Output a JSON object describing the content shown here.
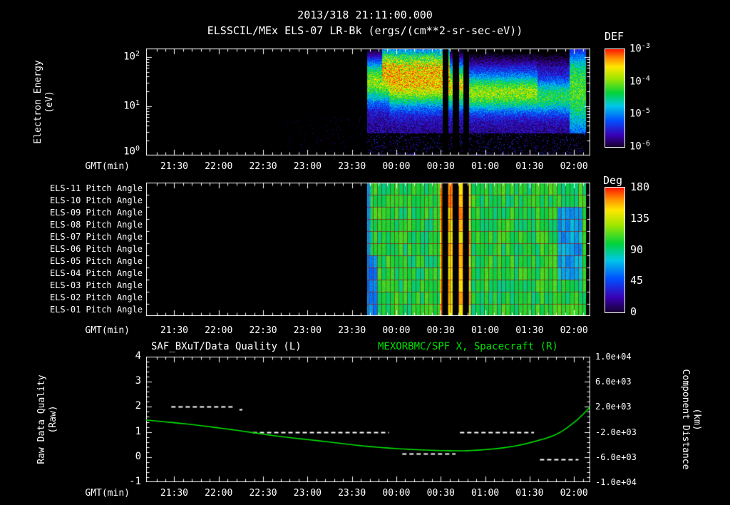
{
  "header": {
    "date": "2013/318 21:11:00.000",
    "title": "ELSSCIL/MEx ELS-07 LR-Bk (ergs/(cm**2-sr-sec-eV))"
  },
  "colormap": {
    "stops": [
      {
        "p": 0.0,
        "c": "#16002f"
      },
      {
        "p": 0.12,
        "c": "#3a00b4"
      },
      {
        "p": 0.27,
        "c": "#0050ff"
      },
      {
        "p": 0.42,
        "c": "#00c8e6"
      },
      {
        "p": 0.55,
        "c": "#00d23c"
      },
      {
        "p": 0.7,
        "c": "#a0e600"
      },
      {
        "p": 0.82,
        "c": "#ffe600"
      },
      {
        "p": 0.91,
        "c": "#ff8c00"
      },
      {
        "p": 1.0,
        "c": "#ff1400"
      }
    ]
  },
  "time_axis": {
    "start": "21:11",
    "end": "02:11",
    "span_minutes": 300,
    "ticks": [
      "21:30",
      "22:00",
      "22:30",
      "23:00",
      "23:30",
      "00:00",
      "00:30",
      "01:00",
      "01:30",
      "02:00"
    ]
  },
  "chart_data": [
    {
      "type": "heatmap",
      "name": "electron-energy-spectrogram",
      "ylabel_line1": "Electron Energy",
      "ylabel_line2": "(eV)",
      "y_scale": "log",
      "y_ticks": [
        "10^2",
        "10^1",
        "10^0"
      ],
      "x_label": "GMT(min)",
      "colorbar": {
        "label": "DEF",
        "units": "ergs/(cm**2-sr-sec-eV)",
        "ticks": [
          "10^-3",
          "10^-4",
          "10^-5",
          "10^-6"
        ],
        "log10_range": [
          -6,
          -3
        ]
      },
      "coverage": {
        "start": "23:40",
        "end": "02:08"
      },
      "gaps": [
        [
          "00:31",
          "00:35"
        ],
        [
          "00:38",
          "00:42"
        ],
        [
          "00:45",
          "00:49"
        ]
      ],
      "background_log10_flux": -5.7,
      "bands": [
        {
          "t0": "23:40",
          "t1": "23:55",
          "center_logE": 1.5,
          "width": 0.3,
          "amp": 1.7
        },
        {
          "t0": "23:55",
          "t1": "00:49",
          "center_logE": 1.42,
          "width": 0.3,
          "amp": 2.0
        },
        {
          "t0": "00:49",
          "t1": "01:35",
          "center_logE": 1.28,
          "width": 0.26,
          "amp": 1.75
        },
        {
          "t0": "01:35",
          "t1": "01:57",
          "center_logE": 1.2,
          "width": 0.24,
          "amp": 1.35
        },
        {
          "t0": "01:57",
          "t1": "02:08",
          "center_logE": 1.35,
          "width": 0.65,
          "amp": 1.5
        }
      ],
      "top_blobs": [
        {
          "t0": "23:50",
          "t1": "00:36",
          "center_logE": 1.95,
          "width": 0.25,
          "amp": 1.4
        }
      ]
    },
    {
      "type": "heatmap",
      "name": "pitch-angle-panels",
      "rows": [
        "ELS-11 Pitch Angle",
        "ELS-10 Pitch Angle",
        "ELS-09 Pitch Angle",
        "ELS-08 Pitch Angle",
        "ELS-07 Pitch Angle",
        "ELS-06 Pitch Angle",
        "ELS-05 Pitch Angle",
        "ELS-04 Pitch Angle",
        "ELS-03 Pitch Angle",
        "ELS-02 Pitch Angle",
        "ELS-01 Pitch Angle"
      ],
      "x_label": "GMT(min)",
      "colorbar": {
        "label": "Deg",
        "ticks": [
          180,
          135,
          90,
          45,
          0
        ],
        "range": [
          0,
          180
        ]
      },
      "coverage": {
        "start": "23:40",
        "end": "02:08"
      },
      "gaps": [
        [
          "00:31",
          "00:35"
        ],
        [
          "00:38",
          "00:42"
        ],
        [
          "00:45",
          "00:49"
        ]
      ],
      "typical_deg": 100,
      "hot_interval": {
        "t0": "00:29",
        "t1": "00:50",
        "deg": 150
      },
      "cool_regions": [
        {
          "t0": "23:40",
          "t1": "23:47",
          "rows": "ELS-01..ELS-05",
          "deg": 58
        },
        {
          "t0": "01:49",
          "t1": "02:05",
          "rows": "ELS-04..ELS-09",
          "deg": 62
        }
      ]
    },
    {
      "type": "line",
      "name": "quality-and-distance",
      "x_label": "GMT(min)",
      "left_axis": {
        "label_line1": "Raw Data Quality",
        "label_line2": "(Raw)",
        "ticks": [
          4,
          3,
          2,
          1,
          0,
          -1
        ],
        "range": [
          -1,
          4
        ]
      },
      "right_axis": {
        "label_line1": "Component Distance",
        "label_line2": "(km)",
        "ticks": [
          {
            "label": "1.0e+04",
            "km": 10000
          },
          {
            "label": "6.0e+03",
            "km": 6000
          },
          {
            "label": "2.0e+03",
            "km": 2000
          },
          {
            "label": "-2.0e+03",
            "km": -2000
          },
          {
            "label": "-6.0e+03",
            "km": -6000
          },
          {
            "label": "-1.0e+04",
            "km": -10000
          }
        ],
        "range_km": [
          -10000,
          10000
        ]
      },
      "left_series": {
        "name": "SAF_BXuT/Data Quality (L)",
        "color": "#ffffff",
        "style": "dashed",
        "axis": "left",
        "segments": [
          {
            "t0": "21:28",
            "t1": "22:10",
            "value": 2.0
          },
          {
            "t0": "22:14",
            "t1": "22:16",
            "value": 1.9
          },
          {
            "t0": "22:23",
            "t1": "23:55",
            "value": 1.0
          },
          {
            "t0": "00:04",
            "t1": "00:40",
            "value": 0.15
          },
          {
            "t0": "00:43",
            "t1": "01:33",
            "value": 1.0
          },
          {
            "t0": "01:37",
            "t1": "02:03",
            "value": -0.1
          }
        ]
      },
      "right_series": {
        "name": "MEXORBMC/SPF X, Spacecraft (R)",
        "color": "#00e000",
        "style": "solid",
        "axis": "right",
        "points": [
          {
            "t": "21:11",
            "km": -100
          },
          {
            "t": "21:41",
            "km": -800
          },
          {
            "t": "22:11",
            "km": -1700
          },
          {
            "t": "22:41",
            "km": -2700
          },
          {
            "t": "23:11",
            "km": -3500
          },
          {
            "t": "23:41",
            "km": -4300
          },
          {
            "t": "00:11",
            "km": -4800
          },
          {
            "t": "00:41",
            "km": -5000
          },
          {
            "t": "01:01",
            "km": -4800
          },
          {
            "t": "01:21",
            "km": -4200
          },
          {
            "t": "01:41",
            "km": -3000
          },
          {
            "t": "01:51",
            "km": -2000
          },
          {
            "t": "02:01",
            "km": -300
          },
          {
            "t": "02:06",
            "km": 800
          },
          {
            "t": "02:11",
            "km": 2000
          }
        ]
      }
    }
  ]
}
